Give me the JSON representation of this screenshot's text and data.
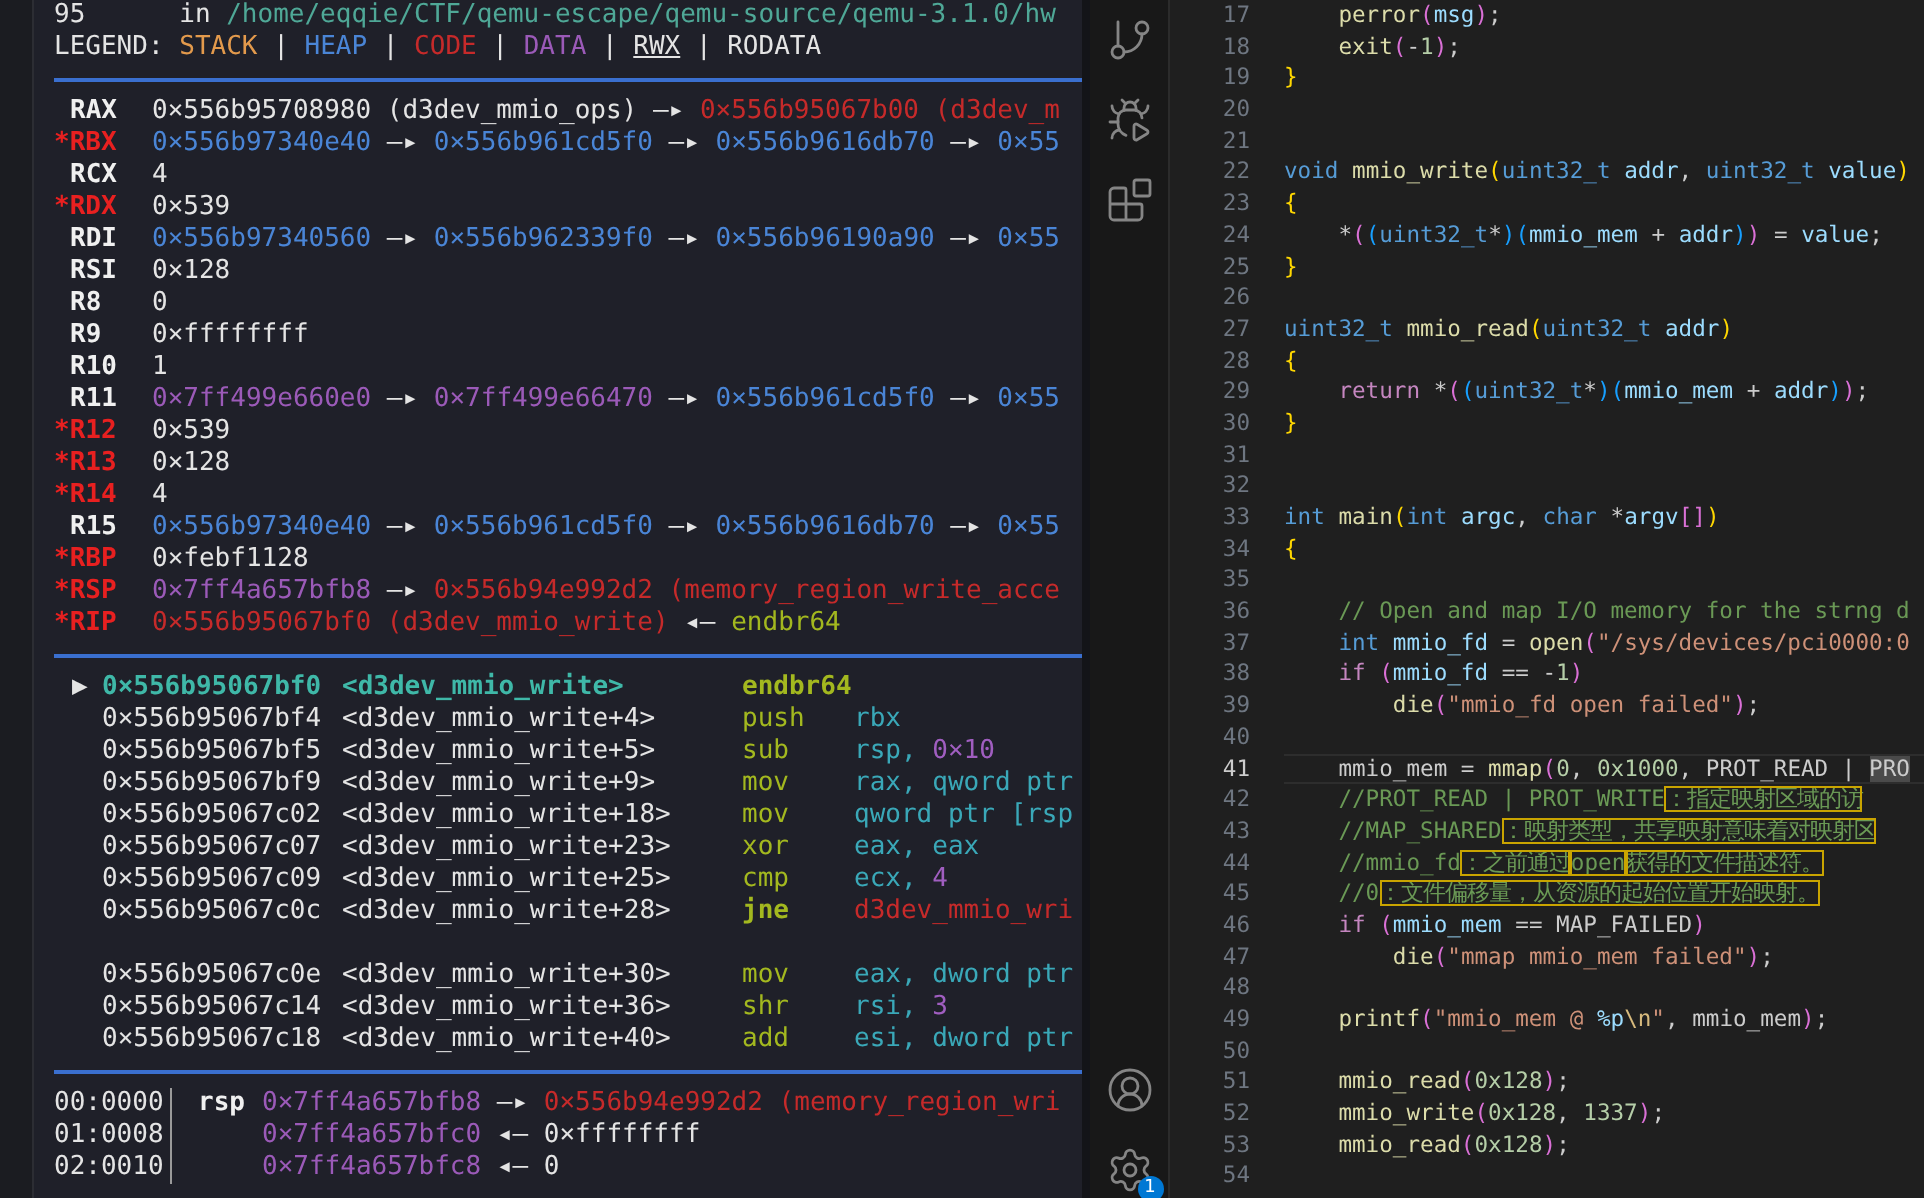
{
  "terminal": {
    "header": [
      {
        "text": "95      in ",
        "kind": "plain"
      },
      {
        "text": "/home/eqqie/CTF/qemu-escape/qemu-source/qemu-3.1.0/hw",
        "kind": "path"
      }
    ],
    "legend": [
      {
        "text": "LEGEND: ",
        "kind": "plain"
      },
      {
        "text": "STACK",
        "kind": "stack"
      },
      {
        "text": " | ",
        "kind": "plain"
      },
      {
        "text": "HEAP",
        "kind": "heap"
      },
      {
        "text": " | ",
        "kind": "plain"
      },
      {
        "text": "CODE",
        "kind": "code"
      },
      {
        "text": " | ",
        "kind": "plain"
      },
      {
        "text": "DATA",
        "kind": "data"
      },
      {
        "text": " | ",
        "kind": "plain"
      },
      {
        "text": "RWX",
        "kind": "rwx"
      },
      {
        "text": " | ",
        "kind": "plain"
      },
      {
        "text": "RODATA",
        "kind": "plain"
      }
    ],
    "registers": [
      {
        "name": "RAX",
        "changed": false,
        "value": [
          {
            "text": "0×556b95708980 (d3dev_mmio_ops) —▸ ",
            "kind": "plain"
          },
          {
            "text": "0×556b95067b00 (d3dev_m",
            "kind": "code"
          }
        ]
      },
      {
        "name": "*RBX",
        "changed": true,
        "value": [
          {
            "text": "0×556b97340e40",
            "kind": "heap"
          },
          {
            "text": " —▸ ",
            "kind": "plain"
          },
          {
            "text": "0×556b961cd5f0",
            "kind": "heap"
          },
          {
            "text": " —▸ ",
            "kind": "plain"
          },
          {
            "text": "0×556b9616db70",
            "kind": "heap"
          },
          {
            "text": " —▸ ",
            "kind": "plain"
          },
          {
            "text": "0×55",
            "kind": "heap"
          }
        ]
      },
      {
        "name": "RCX",
        "changed": false,
        "value": [
          {
            "text": "4",
            "kind": "plain"
          }
        ]
      },
      {
        "name": "*RDX",
        "changed": true,
        "value": [
          {
            "text": "0×539",
            "kind": "plain"
          }
        ]
      },
      {
        "name": "RDI",
        "changed": false,
        "value": [
          {
            "text": "0×556b97340560",
            "kind": "heap"
          },
          {
            "text": " —▸ ",
            "kind": "plain"
          },
          {
            "text": "0×556b962339f0",
            "kind": "heap"
          },
          {
            "text": " —▸ ",
            "kind": "plain"
          },
          {
            "text": "0×556b96190a90",
            "kind": "heap"
          },
          {
            "text": " —▸ ",
            "kind": "plain"
          },
          {
            "text": "0×55",
            "kind": "heap"
          }
        ]
      },
      {
        "name": "RSI",
        "changed": false,
        "value": [
          {
            "text": "0×128",
            "kind": "plain"
          }
        ]
      },
      {
        "name": "R8",
        "changed": false,
        "value": [
          {
            "text": "0",
            "kind": "plain"
          }
        ]
      },
      {
        "name": "R9",
        "changed": false,
        "value": [
          {
            "text": "0×ffffffff",
            "kind": "plain"
          }
        ]
      },
      {
        "name": "R10",
        "changed": false,
        "value": [
          {
            "text": "1",
            "kind": "plain"
          }
        ]
      },
      {
        "name": "R11",
        "changed": false,
        "value": [
          {
            "text": "0×7ff499e660e0",
            "kind": "data"
          },
          {
            "text": " —▸ ",
            "kind": "plain"
          },
          {
            "text": "0×7ff499e66470",
            "kind": "data"
          },
          {
            "text": " —▸ ",
            "kind": "plain"
          },
          {
            "text": "0×556b961cd5f0",
            "kind": "heap"
          },
          {
            "text": " —▸ ",
            "kind": "plain"
          },
          {
            "text": "0×55",
            "kind": "heap"
          }
        ]
      },
      {
        "name": "*R12",
        "changed": true,
        "value": [
          {
            "text": "0×539",
            "kind": "plain"
          }
        ]
      },
      {
        "name": "*R13",
        "changed": true,
        "value": [
          {
            "text": "0×128",
            "kind": "plain"
          }
        ]
      },
      {
        "name": "*R14",
        "changed": true,
        "value": [
          {
            "text": "4",
            "kind": "plain"
          }
        ]
      },
      {
        "name": "R15",
        "changed": false,
        "value": [
          {
            "text": "0×556b97340e40",
            "kind": "heap"
          },
          {
            "text": " —▸ ",
            "kind": "plain"
          },
          {
            "text": "0×556b961cd5f0",
            "kind": "heap"
          },
          {
            "text": " —▸ ",
            "kind": "plain"
          },
          {
            "text": "0×556b9616db70",
            "kind": "heap"
          },
          {
            "text": " —▸ ",
            "kind": "plain"
          },
          {
            "text": "0×55",
            "kind": "heap"
          }
        ]
      },
      {
        "name": "*RBP",
        "changed": true,
        "value": [
          {
            "text": "0×febf1128",
            "kind": "plain"
          }
        ]
      },
      {
        "name": "*RSP",
        "changed": true,
        "value": [
          {
            "text": "0×7ff4a657bfb8",
            "kind": "data"
          },
          {
            "text": " —▸ ",
            "kind": "plain"
          },
          {
            "text": "0×556b94e992d2 (memory_region_write_acce",
            "kind": "code"
          }
        ]
      },
      {
        "name": "*RIP",
        "changed": true,
        "value": [
          {
            "text": "0×556b95067bf0 (d3dev_mmio_write)",
            "kind": "code"
          },
          {
            "text": " ◂— ",
            "kind": "plain"
          },
          {
            "text": "endbr64",
            "kind": "asm"
          }
        ]
      }
    ],
    "disassembly": [
      {
        "kind": "instruction",
        "current": true,
        "marker": "▶",
        "address": "0×556b95067bf0",
        "symbol": "<d3dev_mmio_write>",
        "mnemonic": "endbr64"
      },
      {
        "kind": "instruction",
        "current": false,
        "address": "0×556b95067bf4",
        "symbol": "<d3dev_mmio_write+4>",
        "mnemonic": "push",
        "operands": [
          {
            "text": "rbx",
            "kind": "operand"
          }
        ]
      },
      {
        "kind": "instruction",
        "current": false,
        "address": "0×556b95067bf5",
        "symbol": "<d3dev_mmio_write+5>",
        "mnemonic": "sub",
        "operands": [
          {
            "text": "rsp, ",
            "kind": "operand"
          },
          {
            "text": "0×10",
            "kind": "number"
          }
        ]
      },
      {
        "kind": "instruction",
        "current": false,
        "address": "0×556b95067bf9",
        "symbol": "<d3dev_mmio_write+9>",
        "mnemonic": "mov",
        "operands": [
          {
            "text": "rax, qword ptr",
            "kind": "operand"
          }
        ]
      },
      {
        "kind": "instruction",
        "current": false,
        "address": "0×556b95067c02",
        "symbol": "<d3dev_mmio_write+18>",
        "mnemonic": "mov",
        "operands": [
          {
            "text": "qword ptr [rsp",
            "kind": "operand"
          }
        ]
      },
      {
        "kind": "instruction",
        "current": false,
        "address": "0×556b95067c07",
        "symbol": "<d3dev_mmio_write+23>",
        "mnemonic": "xor",
        "operands": [
          {
            "text": "eax, eax",
            "kind": "operand"
          }
        ]
      },
      {
        "kind": "instruction",
        "current": false,
        "address": "0×556b95067c09",
        "symbol": "<d3dev_mmio_write+25>",
        "mnemonic": "cmp",
        "operands": [
          {
            "text": "ecx, ",
            "kind": "operand"
          },
          {
            "text": "4",
            "kind": "number"
          }
        ]
      },
      {
        "kind": "jump",
        "current": false,
        "address": "0×556b95067c0c",
        "symbol": "<d3dev_mmio_write+28>",
        "mnemonic": "jne",
        "operands": [
          {
            "text": "d3dev_mmio_wri",
            "kind": "code"
          }
        ]
      },
      {
        "kind": "gap"
      },
      {
        "kind": "instruction",
        "current": false,
        "address": "0×556b95067c0e",
        "symbol": "<d3dev_mmio_write+30>",
        "mnemonic": "mov",
        "operands": [
          {
            "text": "eax, dword ptr",
            "kind": "operand"
          }
        ]
      },
      {
        "kind": "instruction",
        "current": false,
        "address": "0×556b95067c14",
        "symbol": "<d3dev_mmio_write+36>",
        "mnemonic": "shr",
        "operands": [
          {
            "text": "rsi, ",
            "kind": "operand"
          },
          {
            "text": "3",
            "kind": "number"
          }
        ]
      },
      {
        "kind": "instruction",
        "current": false,
        "address": "0×556b95067c18",
        "symbol": "<d3dev_mmio_write+40>",
        "mnemonic": "add",
        "operands": [
          {
            "text": "esi, dword ptr",
            "kind": "operand"
          }
        ]
      }
    ],
    "stack": [
      {
        "offset": "00:0000",
        "register": "rsp",
        "value": [
          {
            "text": "0×7ff4a657bfb8",
            "kind": "data"
          },
          {
            "text": " —▸ ",
            "kind": "plain"
          },
          {
            "text": "0×556b94e992d2 (memory_region_wri",
            "kind": "code"
          }
        ]
      },
      {
        "offset": "01:0008",
        "value": [
          {
            "text": "0×7ff4a657bfc0",
            "kind": "data"
          },
          {
            "text": " ◂— ",
            "kind": "plain"
          },
          {
            "text": "0×ffffffff",
            "kind": "plain"
          }
        ]
      },
      {
        "offset": "02:0010",
        "value": [
          {
            "text": "0×7ff4a657bfc8",
            "kind": "data"
          },
          {
            "text": " ◂— ",
            "kind": "plain"
          },
          {
            "text": "0",
            "kind": "plain"
          }
        ]
      }
    ]
  },
  "activity_bar": {
    "settings_badge": "1"
  },
  "editor": {
    "lines": [
      {
        "number": "17",
        "current": false,
        "tokens": [
          {
            "text": "    perror",
            "kind": "function"
          },
          {
            "text": "(",
            "kind": "bracket2"
          },
          {
            "text": "msg",
            "kind": "variable"
          },
          {
            "text": ")",
            "kind": "bracket2"
          },
          {
            "text": ";",
            "kind": "plain"
          }
        ]
      },
      {
        "number": "18",
        "current": false,
        "tokens": [
          {
            "text": "    exit",
            "kind": "function"
          },
          {
            "text": "(",
            "kind": "bracket2"
          },
          {
            "text": "-",
            "kind": "plain"
          },
          {
            "text": "1",
            "kind": "number"
          },
          {
            "text": ")",
            "kind": "bracket2"
          },
          {
            "text": ";",
            "kind": "plain"
          }
        ]
      },
      {
        "number": "19",
        "current": false,
        "tokens": [
          {
            "text": "}",
            "kind": "bracket1"
          }
        ]
      },
      {
        "number": "20",
        "current": false
      },
      {
        "number": "21",
        "current": false
      },
      {
        "number": "22",
        "current": false,
        "tokens": [
          {
            "text": "void ",
            "kind": "keyword"
          },
          {
            "text": "mmio_write",
            "kind": "function"
          },
          {
            "text": "(",
            "kind": "bracket1"
          },
          {
            "text": "uint32_t",
            "kind": "keyword"
          },
          {
            "text": " addr",
            "kind": "variable"
          },
          {
            "text": ", ",
            "kind": "plain"
          },
          {
            "text": "uint32_t",
            "kind": "keyword"
          },
          {
            "text": " value",
            "kind": "variable"
          },
          {
            "text": ")",
            "kind": "bracket1"
          }
        ]
      },
      {
        "number": "23",
        "current": false,
        "tokens": [
          {
            "text": "{",
            "kind": "bracket1"
          }
        ]
      },
      {
        "number": "24",
        "current": false,
        "tokens": [
          {
            "text": "    *",
            "kind": "plain"
          },
          {
            "text": "(",
            "kind": "bracket2"
          },
          {
            "text": "(",
            "kind": "bracket3"
          },
          {
            "text": "uint32_t",
            "kind": "keyword"
          },
          {
            "text": "*",
            "kind": "plain"
          },
          {
            "text": ")",
            "kind": "bracket3"
          },
          {
            "text": "(",
            "kind": "bracket3"
          },
          {
            "text": "mmio_mem",
            "kind": "variable"
          },
          {
            "text": " + ",
            "kind": "plain"
          },
          {
            "text": "addr",
            "kind": "variable"
          },
          {
            "text": ")",
            "kind": "bracket3"
          },
          {
            "text": ")",
            "kind": "bracket2"
          },
          {
            "text": " = ",
            "kind": "plain"
          },
          {
            "text": "value",
            "kind": "variable"
          },
          {
            "text": ";",
            "kind": "plain"
          }
        ]
      },
      {
        "number": "25",
        "current": false,
        "tokens": [
          {
            "text": "}",
            "kind": "bracket1"
          }
        ]
      },
      {
        "number": "26",
        "current": false
      },
      {
        "number": "27",
        "current": false,
        "tokens": [
          {
            "text": "uint32_t ",
            "kind": "keyword"
          },
          {
            "text": "mmio_read",
            "kind": "function"
          },
          {
            "text": "(",
            "kind": "bracket1"
          },
          {
            "text": "uint32_t",
            "kind": "keyword"
          },
          {
            "text": " addr",
            "kind": "variable"
          },
          {
            "text": ")",
            "kind": "bracket1"
          }
        ]
      },
      {
        "number": "28",
        "current": false,
        "tokens": [
          {
            "text": "{",
            "kind": "bracket1"
          }
        ]
      },
      {
        "number": "29",
        "current": false,
        "tokens": [
          {
            "text": "    return",
            "kind": "control"
          },
          {
            "text": " *",
            "kind": "plain"
          },
          {
            "text": "(",
            "kind": "bracket2"
          },
          {
            "text": "(",
            "kind": "bracket3"
          },
          {
            "text": "uint32_t",
            "kind": "keyword"
          },
          {
            "text": "*",
            "kind": "plain"
          },
          {
            "text": ")",
            "kind": "bracket3"
          },
          {
            "text": "(",
            "kind": "bracket3"
          },
          {
            "text": "mmio_mem",
            "kind": "variable"
          },
          {
            "text": " + ",
            "kind": "plain"
          },
          {
            "text": "addr",
            "kind": "variable"
          },
          {
            "text": ")",
            "kind": "bracket3"
          },
          {
            "text": ")",
            "kind": "bracket2"
          },
          {
            "text": ";",
            "kind": "plain"
          }
        ]
      },
      {
        "number": "30",
        "current": false,
        "tokens": [
          {
            "text": "}",
            "kind": "bracket1"
          }
        ]
      },
      {
        "number": "31",
        "current": false
      },
      {
        "number": "32",
        "current": false
      },
      {
        "number": "33",
        "current": false,
        "tokens": [
          {
            "text": "int ",
            "kind": "keyword"
          },
          {
            "text": "main",
            "kind": "function"
          },
          {
            "text": "(",
            "kind": "bracket1"
          },
          {
            "text": "int",
            "kind": "keyword"
          },
          {
            "text": " argc",
            "kind": "variable"
          },
          {
            "text": ", ",
            "kind": "plain"
          },
          {
            "text": "char",
            "kind": "keyword"
          },
          {
            "text": " *",
            "kind": "plain"
          },
          {
            "text": "argv",
            "kind": "variable"
          },
          {
            "text": "[]",
            "kind": "bracket2"
          },
          {
            "text": ")",
            "kind": "bracket1"
          }
        ]
      },
      {
        "number": "34",
        "current": false,
        "tokens": [
          {
            "text": "{",
            "kind": "bracket1"
          }
        ]
      },
      {
        "number": "35",
        "current": false
      },
      {
        "number": "36",
        "current": false,
        "tokens": [
          {
            "text": "    // Open and map I/O memory for the strng d",
            "kind": "comment"
          }
        ]
      },
      {
        "number": "37",
        "current": false,
        "tokens": [
          {
            "text": "    int ",
            "kind": "keyword"
          },
          {
            "text": "mmio_fd",
            "kind": "variable"
          },
          {
            "text": " = ",
            "kind": "plain"
          },
          {
            "text": "open",
            "kind": "function"
          },
          {
            "text": "(",
            "kind": "bracket2"
          },
          {
            "text": "\"/sys/devices/pci0000:0",
            "kind": "string"
          }
        ]
      },
      {
        "number": "38",
        "current": false,
        "tokens": [
          {
            "text": "    if ",
            "kind": "control"
          },
          {
            "text": "(",
            "kind": "bracket2"
          },
          {
            "text": "mmio_fd",
            "kind": "variable"
          },
          {
            "text": " == -",
            "kind": "plain"
          },
          {
            "text": "1",
            "kind": "number"
          },
          {
            "text": ")",
            "kind": "bracket2"
          }
        ]
      },
      {
        "number": "39",
        "current": false,
        "tokens": [
          {
            "text": "        die",
            "kind": "function"
          },
          {
            "text": "(",
            "kind": "bracket2"
          },
          {
            "text": "\"mmio_fd open failed\"",
            "kind": "string"
          },
          {
            "text": ")",
            "kind": "bracket2"
          },
          {
            "text": ";",
            "kind": "plain"
          }
        ]
      },
      {
        "number": "40",
        "current": false
      },
      {
        "number": "41",
        "current": true,
        "tokens": [
          {
            "text": "    mmio_mem = ",
            "kind": "plain"
          },
          {
            "text": "mmap",
            "kind": "function"
          },
          {
            "text": "(",
            "kind": "bracket2"
          },
          {
            "text": "0",
            "kind": "number"
          },
          {
            "text": ", ",
            "kind": "plain"
          },
          {
            "text": "0x1000",
            "kind": "number"
          },
          {
            "text": ", PROT_READ | ",
            "kind": "plain"
          },
          {
            "text": "PRO",
            "kind": "match"
          }
        ]
      },
      {
        "number": "42",
        "current": false,
        "tokens": [
          {
            "text": "    //PROT_READ | PROT_WRITE",
            "kind": "comment"
          },
          {
            "text": "：指定映射区域的访",
            "kind": "note"
          }
        ]
      },
      {
        "number": "43",
        "current": false,
        "tokens": [
          {
            "text": "    //MAP_SHARED",
            "kind": "comment"
          },
          {
            "text": "：映射类型，共享映射意味着对映射区",
            "kind": "note"
          }
        ]
      },
      {
        "number": "44",
        "current": false,
        "tokens": [
          {
            "text": "    //mmio_fd",
            "kind": "comment"
          },
          {
            "text": "：之前通过",
            "kind": "note"
          },
          {
            "text": "open",
            "kind": "note"
          },
          {
            "text": "获得的文件描述符。",
            "kind": "note"
          }
        ]
      },
      {
        "number": "45",
        "current": false,
        "tokens": [
          {
            "text": "    //0",
            "kind": "comment"
          },
          {
            "text": "：文件偏移量，从资源的起始位置开始映射。",
            "kind": "note"
          }
        ]
      },
      {
        "number": "46",
        "current": false,
        "tokens": [
          {
            "text": "    if ",
            "kind": "control"
          },
          {
            "text": "(",
            "kind": "bracket2"
          },
          {
            "text": "mmio_mem",
            "kind": "variable"
          },
          {
            "text": " == MAP_FAILED",
            "kind": "plain"
          },
          {
            "text": ")",
            "kind": "bracket2"
          }
        ]
      },
      {
        "number": "47",
        "current": false,
        "tokens": [
          {
            "text": "        die",
            "kind": "function"
          },
          {
            "text": "(",
            "kind": "bracket2"
          },
          {
            "text": "\"mmap mmio_mem failed\"",
            "kind": "string"
          },
          {
            "text": ")",
            "kind": "bracket2"
          },
          {
            "text": ";",
            "kind": "plain"
          }
        ]
      },
      {
        "number": "48",
        "current": false
      },
      {
        "number": "49",
        "current": false,
        "tokens": [
          {
            "text": "    printf",
            "kind": "function"
          },
          {
            "text": "(",
            "kind": "bracket2"
          },
          {
            "text": "\"mmio_mem @ ",
            "kind": "string"
          },
          {
            "text": "%p",
            "kind": "format"
          },
          {
            "text": "\\n",
            "kind": "escape"
          },
          {
            "text": "\"",
            "kind": "string"
          },
          {
            "text": ", mmio_mem",
            "kind": "plain"
          },
          {
            "text": ")",
            "kind": "bracket2"
          },
          {
            "text": ";",
            "kind": "plain"
          }
        ]
      },
      {
        "number": "50",
        "current": false
      },
      {
        "number": "51",
        "current": false,
        "tokens": [
          {
            "text": "    mmio_read",
            "kind": "function"
          },
          {
            "text": "(",
            "kind": "bracket2"
          },
          {
            "text": "0x128",
            "kind": "number"
          },
          {
            "text": ")",
            "kind": "bracket2"
          },
          {
            "text": ";",
            "kind": "plain"
          }
        ]
      },
      {
        "number": "52",
        "current": false,
        "tokens": [
          {
            "text": "    mmio_write",
            "kind": "function"
          },
          {
            "text": "(",
            "kind": "bracket2"
          },
          {
            "text": "0x128",
            "kind": "number"
          },
          {
            "text": ", ",
            "kind": "plain"
          },
          {
            "text": "1337",
            "kind": "number"
          },
          {
            "text": ")",
            "kind": "bracket2"
          },
          {
            "text": ";",
            "kind": "plain"
          }
        ]
      },
      {
        "number": "53",
        "current": false,
        "tokens": [
          {
            "text": "    mmio_read",
            "kind": "function"
          },
          {
            "text": "(",
            "kind": "bracket2"
          },
          {
            "text": "0x128",
            "kind": "number"
          },
          {
            "text": ")",
            "kind": "bracket2"
          },
          {
            "text": ";",
            "kind": "plain"
          }
        ]
      },
      {
        "number": "54",
        "current": false
      }
    ]
  }
}
